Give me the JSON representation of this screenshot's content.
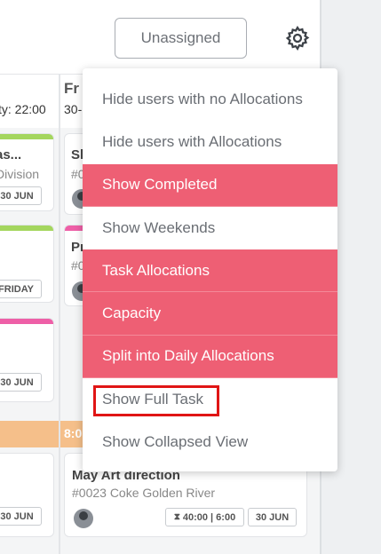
{
  "header": {
    "unassigned_label": "Unassigned",
    "settings_icon": "gear-icon"
  },
  "columns": [
    {
      "title": "",
      "subtitle": "ty: 22:00"
    },
    {
      "title": "Fr",
      "subtitle": "30-"
    }
  ],
  "left_cards": [
    {
      "title": "as...",
      "subtitle": "Division",
      "date": "30 JUN",
      "color": "#a4d65e"
    },
    {
      "title": "",
      "subtitle": "",
      "date": "FRIDAY",
      "color": "#a4d65e"
    },
    {
      "title": "",
      "subtitle": "",
      "date": "30 JUN",
      "color": "#ee5fa7"
    },
    {
      "title": "",
      "subtitle": "",
      "date": "30 JUN",
      "color": ""
    }
  ],
  "right_cards": [
    {
      "title": "Sl",
      "subtitle": "#0"
    },
    {
      "title": "Pr",
      "subtitle": "#0",
      "color": "#ee5fa7"
    }
  ],
  "time_band": {
    "label": "8:0"
  },
  "bottom_card": {
    "title": "May Art direction",
    "subtitle": "#0023 Coke Golden River",
    "hours": "40:00 | 6:00",
    "date": "30 JUN"
  },
  "menu": {
    "items": [
      {
        "label": "Hide users with no Allocations",
        "active": false
      },
      {
        "label": "Hide users with Allocations",
        "active": false
      },
      {
        "label": "Show Completed",
        "active": true
      },
      {
        "label": "Show Weekends",
        "active": false
      },
      {
        "label": "Task Allocations",
        "active": true
      },
      {
        "label": "Capacity",
        "active": true
      },
      {
        "label": "Split into Daily Allocations",
        "active": true
      },
      {
        "label": "Show Full Task",
        "active": false
      },
      {
        "label": "Show Collapsed View",
        "active": false
      }
    ],
    "accent_color": "#ee5f74"
  }
}
